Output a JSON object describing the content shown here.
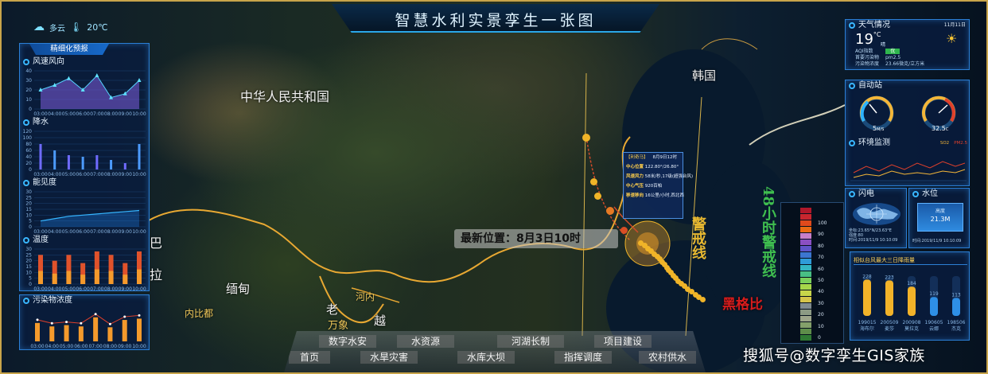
{
  "header": {
    "title": "智慧水利实景孪生一张图",
    "weather_label": "多云",
    "temperature": "20℃"
  },
  "left_panel": {
    "title": "精细化预报",
    "wind": {
      "title": "风速风向",
      "y_ticks": [
        "0",
        "10",
        "20",
        "30",
        "40"
      ],
      "x_ticks": [
        "03:00",
        "04:00",
        "05:00",
        "06:00",
        "07:00",
        "08:00",
        "09:00",
        "10:00"
      ],
      "values": [
        20,
        25,
        32,
        20,
        35,
        12,
        16,
        30
      ]
    },
    "rain": {
      "title": "降水",
      "y_ticks": [
        "0",
        "20",
        "40",
        "60",
        "80",
        "100",
        "120"
      ],
      "x_ticks": [
        "03:00",
        "04:00",
        "05:00",
        "06:00",
        "07:00",
        "08:00",
        "09:00",
        "10:00"
      ],
      "values": [
        80,
        60,
        45,
        40,
        45,
        30,
        20,
        80
      ]
    },
    "visibility": {
      "title": "能见度",
      "y_ticks": [
        "0",
        "5",
        "10",
        "15",
        "20",
        "25",
        "30"
      ],
      "x_ticks": [
        "03:00",
        "04:00",
        "05:00",
        "06:00",
        "07:00",
        "08:00",
        "09:00",
        "10:00"
      ],
      "values": [
        5,
        7,
        9,
        10,
        11,
        12,
        13,
        14
      ]
    },
    "temp": {
      "title": "温度",
      "y_ticks": [
        "0",
        "5",
        "10",
        "15",
        "20",
        "25",
        "30"
      ],
      "x_ticks": [
        "03:00",
        "04:00",
        "05:00",
        "06:00",
        "07:00",
        "08:00",
        "09:00",
        "10:00"
      ],
      "values": [
        25,
        20,
        25,
        18,
        28,
        25,
        18,
        28
      ]
    }
  },
  "pollution_panel": {
    "title": "污染物浓度",
    "x_ticks": [
      "03:00",
      "04:00",
      "05:00",
      "06:00",
      "07:00",
      "08:00",
      "09:00",
      "10:00"
    ],
    "values": [
      50,
      42,
      45,
      42,
      63,
      40,
      57,
      60
    ]
  },
  "map": {
    "china": "中华人民共和国",
    "korea": "韩国",
    "myanmar": "缅甸",
    "laos": "老",
    "laos2": "万象",
    "vietnam": "越",
    "hanoi": "河内",
    "naypyidaw": "内比都",
    "la": "拉",
    "pa": "巴",
    "warning_48": "48小时警戒线",
    "warning_24": "警戒线",
    "typhoon_name": "黑格比"
  },
  "typhoon_info": {
    "title": "【利奇马】",
    "time": "8月9日12时",
    "rows": [
      {
        "k": "中心位置",
        "v": "122.80°/26.80°"
      },
      {
        "k": "风速风力",
        "v": "58米/秒,17级(超强台风)"
      },
      {
        "k": "中心气压",
        "v": "920百帕"
      },
      {
        "k": "移速移向",
        "v": "16公里/小时,西北西"
      }
    ]
  },
  "latest_position": "最新位置：8月3日10时",
  "legend": {
    "labels": [
      "100",
      "90",
      "80",
      "70",
      "60",
      "50",
      "40",
      "30",
      "20",
      "10",
      "0"
    ],
    "colors": [
      "#b0182a",
      "#c8262e",
      "#e04a1c",
      "#e96b13",
      "#c77fc9",
      "#8a4fc2",
      "#5f55c9",
      "#3c76d0",
      "#2f9bd8",
      "#34b6c2",
      "#48bf84",
      "#7acf5b",
      "#a6d74a",
      "#c7d54a",
      "#d5c44a",
      "#7f8b8f",
      "#8c9a84",
      "#9da58a",
      "#84a06a",
      "#5e8d4a",
      "#2f7a34"
    ]
  },
  "nav": {
    "row1": [
      "数字水安",
      "水资源",
      "河湖长制",
      "项目建设"
    ],
    "row2": [
      "首页",
      "水旱灾害",
      "水库大坝",
      "指挥调度",
      "农村供水"
    ]
  },
  "watermark": "搜狐号@数字孪生GIS家族",
  "weather_panel": {
    "title": "天气情况",
    "date": "11月11日",
    "temp": "19",
    "unit": "°C",
    "cond": "晴",
    "aqi_label": "AQI指数",
    "aqi_value": "优",
    "pollutant_label": "首要污染物",
    "pollutant_value": "pm2.5",
    "conc_label": "污染物浓度",
    "conc_value": "23.66微克/立方米"
  },
  "auto_station": {
    "title": "自动站",
    "wind_value": "5",
    "wind_unit": "M/S",
    "temp_value": "32.5",
    "temp_unit": "C"
  },
  "env": {
    "title": "环境监测",
    "legend": [
      "SO2",
      "PM2.5"
    ]
  },
  "lightning": {
    "title": "闪电",
    "coord": "坐标:23.65°N/23.63°E",
    "bearing": "强度:80",
    "time": "时间:2019/11/9 10:10:09"
  },
  "water_level": {
    "title": "水位",
    "label": "高度",
    "value": "21.3M",
    "time": "时间:2019/11/9 10:10:09"
  },
  "rainfall": {
    "title": "相似台风最大三日降雨量",
    "ids": [
      "199015",
      "200509",
      "200908",
      "190605",
      "198506"
    ],
    "names": [
      "海布尔",
      "麦莎",
      "莫拉克",
      "云娜",
      "杰克"
    ],
    "values": [
      228,
      223,
      184,
      119,
      113
    ]
  }
}
